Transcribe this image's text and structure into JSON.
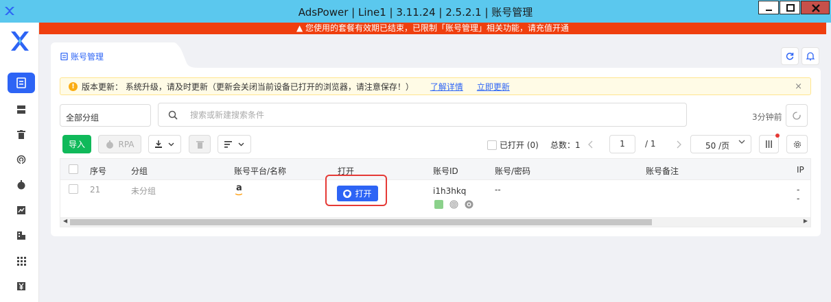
{
  "window": {
    "title": "AdsPower | Line1 | 3.11.24 | 2.5.2.1 | 账号管理"
  },
  "banner": {
    "text": "▲ 您使用的套餐有效期已结束，已限制「账号管理」相关功能，请充值开通"
  },
  "tab": {
    "label": "账号管理"
  },
  "notice": {
    "text": "版本更新：  系统升级，请及时更新（更新会关闭当前设备已打开的浏览器，请注意保存！）",
    "link_details": "了解详情",
    "link_update": "立即更新",
    "close": "×"
  },
  "filters": {
    "group": "全部分组",
    "search_placeholder": "搜索或新建搜索条件",
    "last_update": "3分钟前"
  },
  "toolbar": {
    "import": "导入",
    "rpa": "RPA",
    "opened": "已打开 (0)",
    "total": "总数：1",
    "page": "1",
    "page_total": "/  1",
    "page_size": "50 /页"
  },
  "table": {
    "headers": {
      "seq": "序号",
      "group": "分组",
      "platform": "账号平台/名称",
      "open": "打开",
      "id": "账号ID",
      "account": "账号/密码",
      "remark": "账号备注",
      "ip": "IP"
    },
    "rows": [
      {
        "seq": "21",
        "group": "未分组",
        "platform_logo": "a",
        "open_label": "打开",
        "id": "i1h3hkq",
        "account": "--",
        "ip1": "-",
        "ip2": "-"
      }
    ]
  },
  "colors": {
    "titlebar": "#5bc8ee",
    "banner": "#ef3f0f",
    "accent": "#2d64f5",
    "import": "#10b95a",
    "highlight": "#e53935"
  }
}
